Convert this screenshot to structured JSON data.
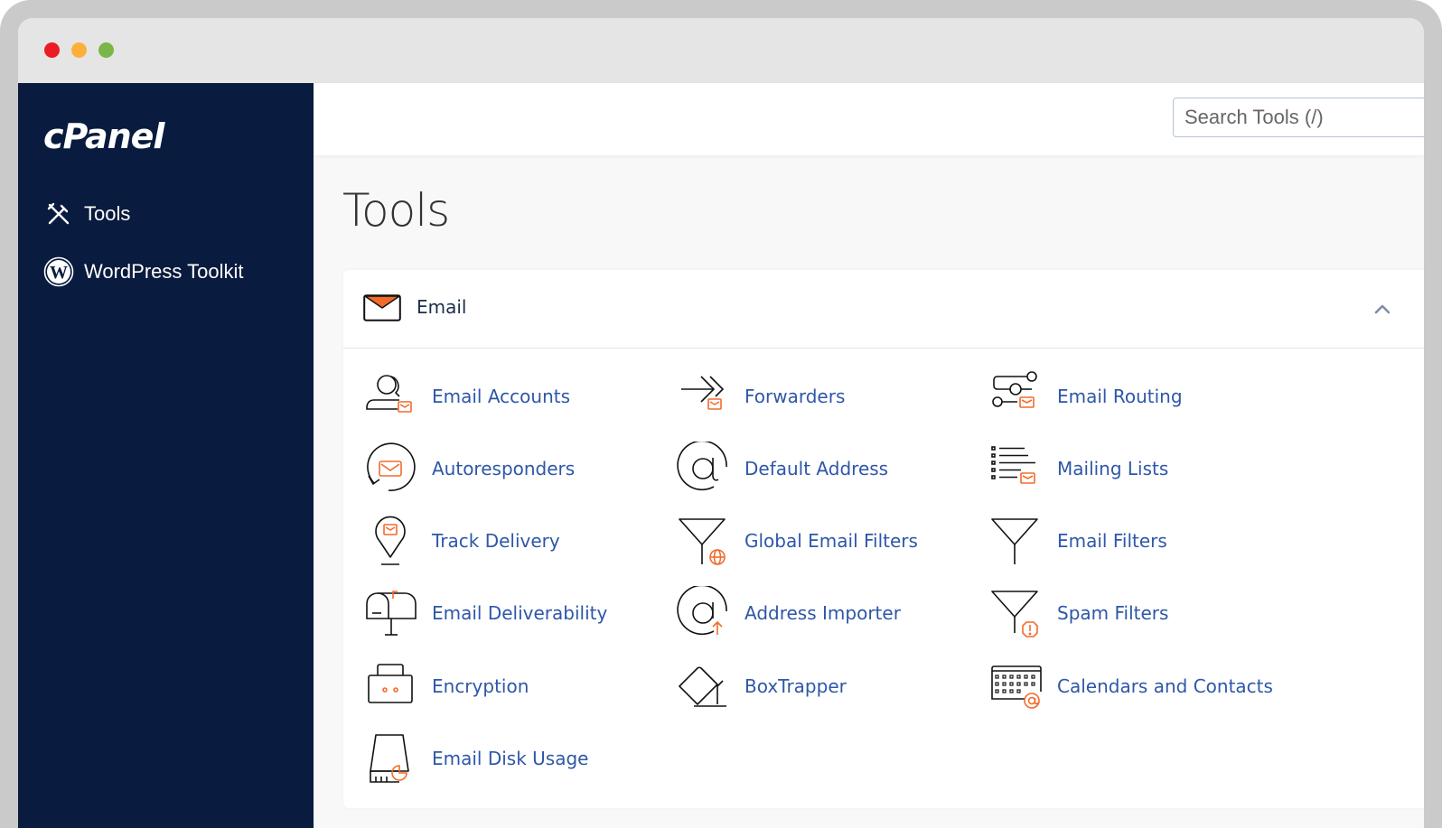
{
  "window": {
    "controls": [
      "close",
      "minimize",
      "maximize"
    ]
  },
  "sidebar": {
    "logo": "cPanel",
    "items": [
      {
        "label": "Tools",
        "icon": "tools-icon"
      },
      {
        "label": "WordPress Toolkit",
        "icon": "wordpress-icon"
      }
    ]
  },
  "header": {
    "search_placeholder": "Search Tools (/)"
  },
  "main": {
    "title": "Tools",
    "section": {
      "title": "Email",
      "icon": "envelope-icon",
      "expanded": true,
      "tools": [
        {
          "label": "Email Accounts",
          "icon": "user-mail-icon"
        },
        {
          "label": "Forwarders",
          "icon": "forward-arrow-icon"
        },
        {
          "label": "Email Routing",
          "icon": "routing-icon"
        },
        {
          "label": "Autoresponders",
          "icon": "circular-arrow-mail-icon"
        },
        {
          "label": "Default Address",
          "icon": "at-sign-icon"
        },
        {
          "label": "Mailing Lists",
          "icon": "list-mail-icon"
        },
        {
          "label": "Track Delivery",
          "icon": "map-pin-mail-icon"
        },
        {
          "label": "Global Email Filters",
          "icon": "filter-globe-icon"
        },
        {
          "label": "Email Filters",
          "icon": "filter-icon"
        },
        {
          "label": "Email Deliverability",
          "icon": "mailbox-icon"
        },
        {
          "label": "Address Importer",
          "icon": "at-upload-icon"
        },
        {
          "label": "Spam Filters",
          "icon": "filter-warning-icon"
        },
        {
          "label": "Encryption",
          "icon": "briefcase-lock-icon"
        },
        {
          "label": "BoxTrapper",
          "icon": "box-trap-icon"
        },
        {
          "label": "Calendars and Contacts",
          "icon": "calendar-at-icon"
        },
        {
          "label": "Email Disk Usage",
          "icon": "disk-usage-icon"
        }
      ]
    }
  },
  "colors": {
    "sidebar_bg": "#091b3e",
    "link": "#2e57a8",
    "accent_orange": "#f26b2b"
  }
}
